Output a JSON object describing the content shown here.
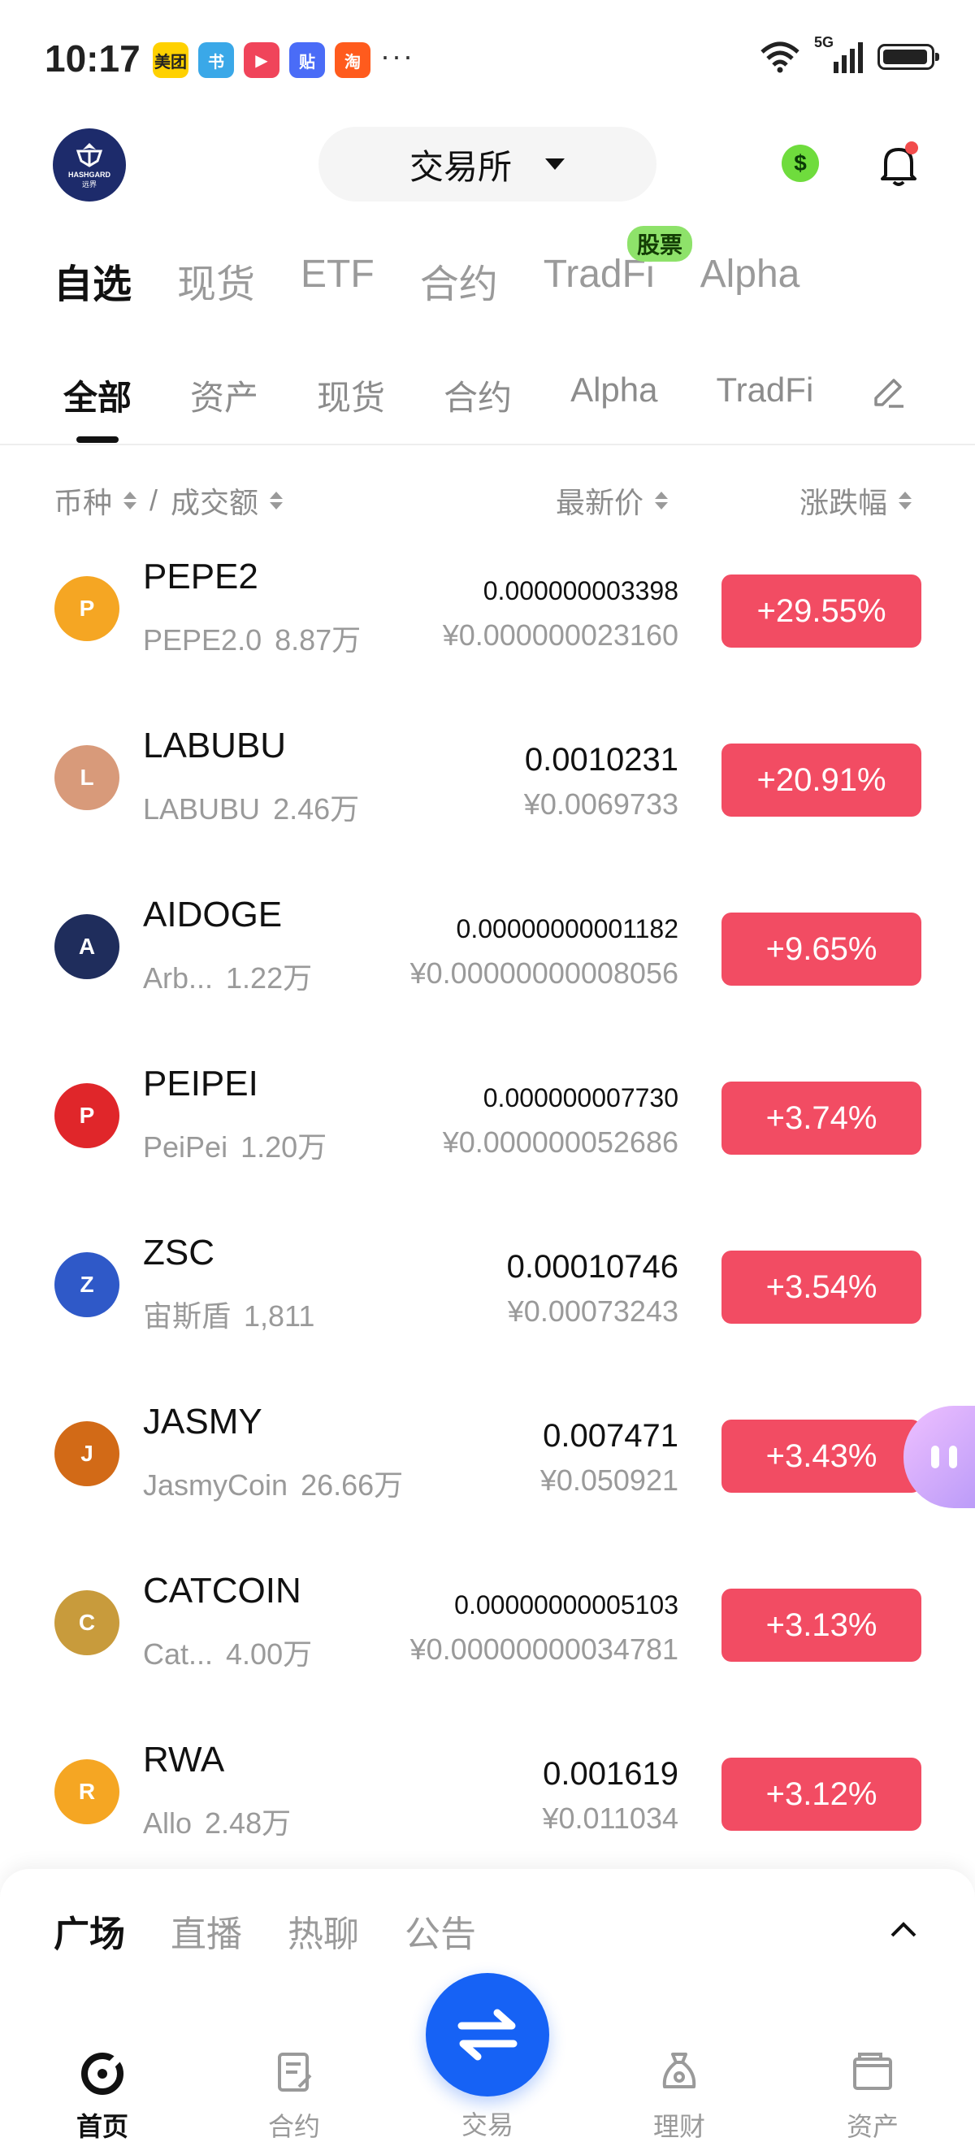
{
  "status_bar": {
    "time": "10:17",
    "apps": [
      {
        "name": "美团",
        "color": "#ffd100",
        "text_color": "#222"
      },
      {
        "name": "书",
        "color": "#3aa8e8",
        "text_color": "#fff"
      },
      {
        "name": "▶",
        "color": "#f0445a",
        "text_color": "#fff"
      },
      {
        "name": "贴",
        "color": "#4a6cf7",
        "text_color": "#fff"
      },
      {
        "name": "淘",
        "color": "#ff5b1d",
        "text_color": "#fff"
      }
    ],
    "more": "···",
    "network": "5G"
  },
  "header": {
    "logo_text": "HASHGARD",
    "logo_sub": "远界",
    "exchange_label": "交易所",
    "coin_icon": "$"
  },
  "main_tabs": [
    {
      "label": "自选",
      "active": true
    },
    {
      "label": "现货",
      "active": false
    },
    {
      "label": "ETF",
      "active": false
    },
    {
      "label": "合约",
      "active": false
    },
    {
      "label": "TradFi",
      "active": false
    },
    {
      "label": "Alpha",
      "active": false
    }
  ],
  "stock_badge": "股票",
  "sub_tabs": [
    {
      "label": "全部",
      "active": true
    },
    {
      "label": "资产",
      "active": false
    },
    {
      "label": "现货",
      "active": false
    },
    {
      "label": "合约",
      "active": false
    },
    {
      "label": "Alpha",
      "active": false
    },
    {
      "label": "TradFi",
      "active": false
    }
  ],
  "columns": {
    "coin": "币种",
    "separator": "/",
    "volume": "成交额",
    "last_price": "最新价",
    "change": "涨跌幅"
  },
  "rows": [
    {
      "symbol": "PEPE2",
      "name": "PEPE2.0",
      "volume": "8.87万",
      "price": "0.000000003398",
      "cny": "¥0.000000023160",
      "change": "+29.55%",
      "logo_color": "#f5a623",
      "logo_text": "P",
      "price_small": true
    },
    {
      "symbol": "LABUBU",
      "name": "LABUBU",
      "volume": "2.46万",
      "price": "0.0010231",
      "cny": "¥0.0069733",
      "change": "+20.91%",
      "logo_color": "#d89a7a",
      "logo_text": "L",
      "price_small": false
    },
    {
      "symbol": "AIDOGE",
      "name": "Arb...",
      "volume": "1.22万",
      "price": "0.00000000001182",
      "cny": "¥0.00000000008056",
      "change": "+9.65%",
      "logo_color": "#1f2d5c",
      "logo_text": "A",
      "price_small": true
    },
    {
      "symbol": "PEIPEI",
      "name": "PeiPei",
      "volume": "1.20万",
      "price": "0.000000007730",
      "cny": "¥0.000000052686",
      "change": "+3.74%",
      "logo_color": "#e0262a",
      "logo_text": "P",
      "price_small": true
    },
    {
      "symbol": "ZSC",
      "name": "宙斯盾",
      "volume": "1,811",
      "price": "0.00010746",
      "cny": "¥0.00073243",
      "change": "+3.54%",
      "logo_color": "#2f59c8",
      "logo_text": "Z",
      "price_small": false
    },
    {
      "symbol": "JASMY",
      "name": "JasmyCoin",
      "volume": "26.66万",
      "price": "0.007471",
      "cny": "¥0.050921",
      "change": "+3.43%",
      "logo_color": "#d26a17",
      "logo_text": "J",
      "price_small": false
    },
    {
      "symbol": "CATCOIN",
      "name": "Cat...",
      "volume": "4.00万",
      "price": "0.00000000005103",
      "cny": "¥0.00000000034781",
      "change": "+3.13%",
      "logo_color": "#c89b3c",
      "logo_text": "C",
      "price_small": true
    },
    {
      "symbol": "RWA",
      "name": "Allo",
      "volume": "2.48万",
      "price": "0.001619",
      "cny": "¥0.011034",
      "change": "+3.12%",
      "logo_color": "#f5a623",
      "logo_text": "R",
      "price_small": false
    }
  ],
  "feed_tabs": [
    {
      "label": "广场",
      "active": true
    },
    {
      "label": "直播",
      "active": false
    },
    {
      "label": "热聊",
      "active": false
    },
    {
      "label": "公告",
      "active": false
    }
  ],
  "bottom_nav": {
    "home": "首页",
    "futures": "合约",
    "trade": "交易",
    "earn": "理财",
    "assets": "资产"
  },
  "colors": {
    "up": "#f24c63",
    "accent": "#1662f5",
    "badge": "#8ee26a"
  }
}
